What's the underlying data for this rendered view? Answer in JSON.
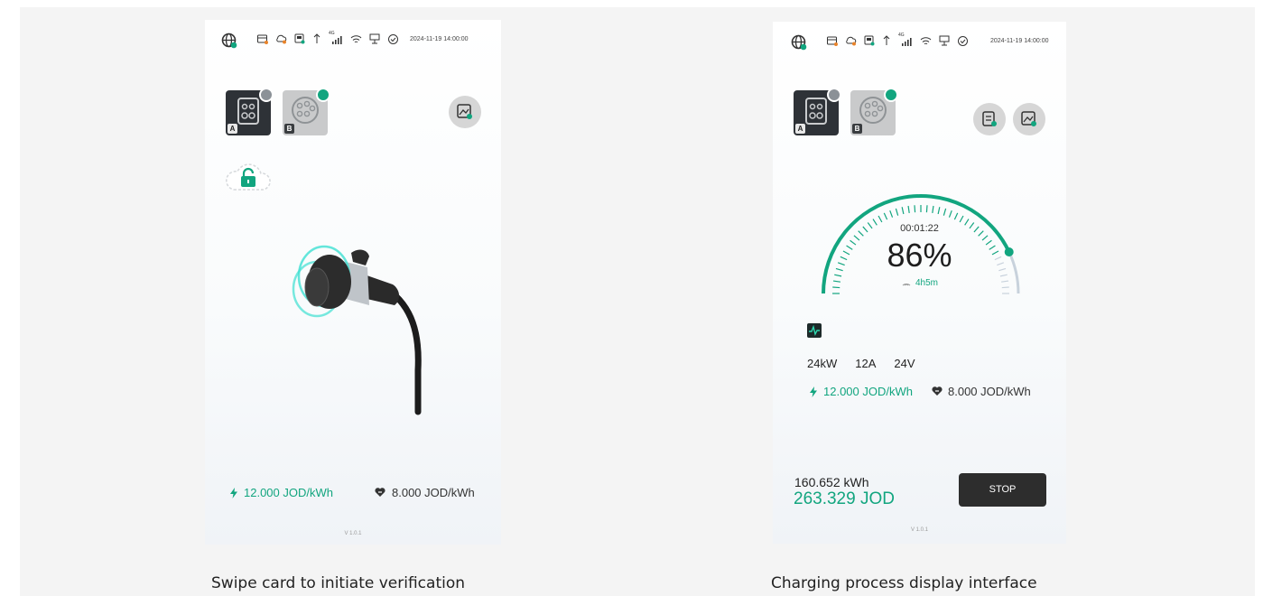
{
  "colors": {
    "accent": "#12a57f",
    "dark": "#2d2d2d",
    "panel_bg": "#f4f4f4"
  },
  "status_bar": {
    "icons": [
      "globe-icon",
      "card-icon",
      "cloud-icon",
      "chip-icon",
      "upload-icon",
      "cellular-4g-icon",
      "wifi-icon",
      "ethernet-icon",
      "cloud-check-icon"
    ],
    "cellular_label": "4G",
    "datetime": "2024-11-19 14:00:00"
  },
  "screens": [
    {
      "caption": "Swipe card to initiate verification",
      "connectors": [
        {
          "label": "A",
          "selected": true
        },
        {
          "label": "B",
          "selected": false
        }
      ],
      "price": {
        "charge": "12.000 JOD/kWh",
        "service": "8.000 JOD/kWh"
      },
      "version": "V 1.0.1"
    },
    {
      "caption": "Charging process display interface",
      "connectors": [
        {
          "label": "A",
          "selected": true
        },
        {
          "label": "B",
          "selected": false
        }
      ],
      "gauge": {
        "elapsed": "00:01:22",
        "percent_label": "86%",
        "percent": 86,
        "remaining": "4h5m"
      },
      "stats": {
        "power": "24kW",
        "current": "12A",
        "voltage": "24V"
      },
      "price": {
        "charge": "12.000 JOD/kWh",
        "service": "8.000 JOD/kWh"
      },
      "energy": "160.652 kWh",
      "cost": "263.329 JOD",
      "stop_label": "STOP",
      "version": "V 1.0.1"
    }
  ]
}
